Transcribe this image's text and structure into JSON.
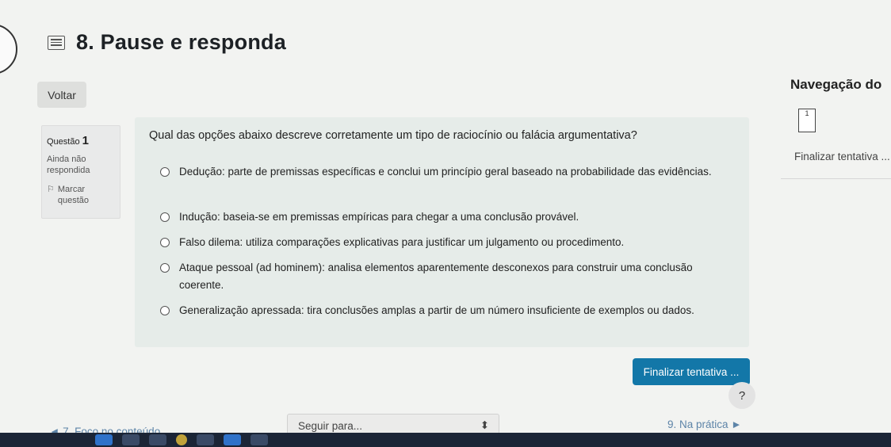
{
  "page": {
    "title": "8. Pause e responda",
    "back_label": "Voltar"
  },
  "question": {
    "label": "Questão",
    "number": "1",
    "status": "Ainda não respondida",
    "flag_label": "Marcar questão",
    "text": "Qual das opções abaixo descreve corretamente um tipo de raciocínio ou falácia argumentativa?",
    "options": [
      "Dedução: parte de premissas específicas e conclui um princípio geral baseado na probabilidade das evidências.",
      "Indução: baseia-se em premissas empíricas para chegar a uma conclusão provável.",
      "Falso dilema: utiliza comparações explicativas para justificar um julgamento ou procedimento.",
      "Ataque pessoal (ad hominem): analisa elementos aparentemente desconexos para construir uma conclusão coerente.",
      "Generalização apressada: tira conclusões amplas a partir de um número insuficiente de exemplos ou dados."
    ]
  },
  "navigation": {
    "title": "Navegação do",
    "question_box": "1",
    "finish_link": "Finalizar tentativa ..."
  },
  "footer": {
    "finish_button": "Finalizar tentativa ...",
    "help": "?",
    "prev_link": "◄ 7. Foco no conteúdo",
    "jump_placeholder": "Seguir para...",
    "jump_arrow": "⬍",
    "next_link": "9. Na prática ►"
  }
}
